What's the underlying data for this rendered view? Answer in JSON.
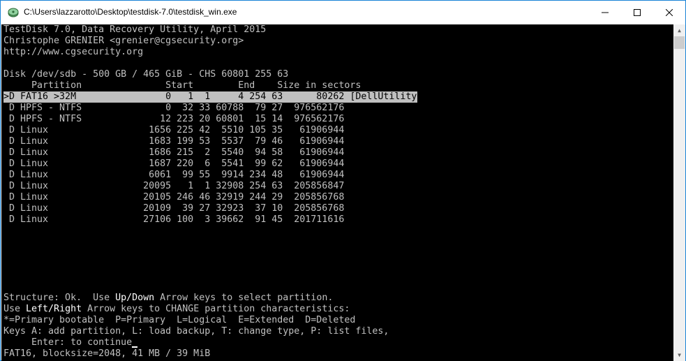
{
  "window": {
    "title": "C:\\Users\\lazzarotto\\Desktop\\testdisk-7.0\\testdisk_win.exe",
    "icon": "testdisk-app-icon",
    "minimize_glyph": "—",
    "maximize_glyph": "☐",
    "close_glyph": "✕"
  },
  "header": {
    "line1": "TestDisk 7.0, Data Recovery Utility, April 2015",
    "line2": "Christophe GRENIER <grenier@cgsecurity.org>",
    "line3": "http://www.cgsecurity.org"
  },
  "disk": {
    "info": "Disk /dev/sdb - 500 GB / 465 GiB - CHS 60801 255 63",
    "columns": "     Partition               Start        End    Size in sectors"
  },
  "partitions": [
    {
      "text": ">D FAT16 >32M                0   1  1     4 254 63      80262 [DellUtility]",
      "selected": true
    },
    {
      "text": " D HPFS - NTFS               0  32 33 60788  79 27  976562176"
    },
    {
      "text": " D HPFS - NTFS              12 223 20 60801  15 14  976562176"
    },
    {
      "text": " D Linux                  1656 225 42  5510 105 35   61906944"
    },
    {
      "text": " D Linux                  1683 199 53  5537  79 46   61906944"
    },
    {
      "text": " D Linux                  1686 215  2  5540  94 58   61906944"
    },
    {
      "text": " D Linux                  1687 220  6  5541  99 62   61906944"
    },
    {
      "text": " D Linux                  6061  99 55  9914 234 48   61906944"
    },
    {
      "text": " D Linux                 20095   1  1 32908 254 63  205856847"
    },
    {
      "text": " D Linux                 20105 246 46 32919 244 29  205856768"
    },
    {
      "text": " D Linux                 20109  39 27 32923  37 10  205856768"
    },
    {
      "text": " D Linux                 27106 100  3 39662  91 45  201711616"
    }
  ],
  "footer": {
    "l1_a": "Structure: Ok.  Use ",
    "l1_b": "Up/Down",
    "l1_c": " Arrow keys to select partition.",
    "l2_a": "Use ",
    "l2_b": "Left/Right",
    "l2_c": " Arrow keys to CHANGE partition characteristics:",
    "l3": "*=Primary bootable  P=Primary  L=Logical  E=Extended  D=Deleted",
    "l4": "Keys A: add partition, L: load backup, T: change type, P: list files,",
    "l5": "     Enter: to continue",
    "l6": "FAT16, blocksize=2048, 41 MB / 39 MiB"
  },
  "colors": {
    "console_bg": "#000000",
    "console_fg": "#c0c0c0",
    "selection_bg": "#c0c0c0",
    "highlight_fg": "#ffffff"
  }
}
